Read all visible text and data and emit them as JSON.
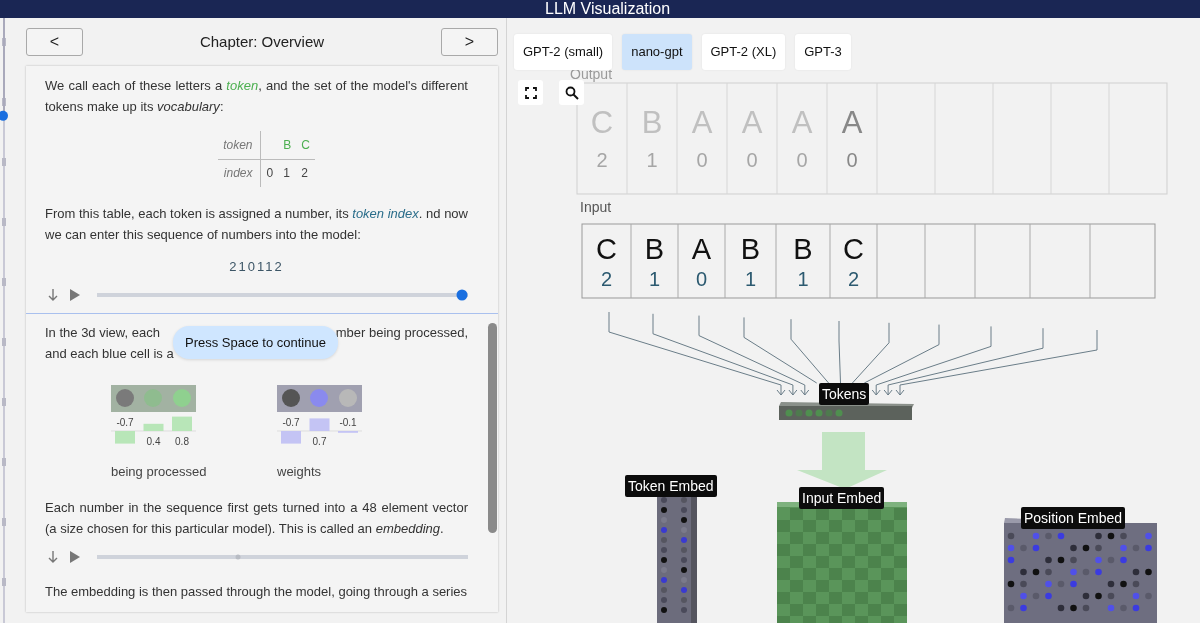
{
  "header": {
    "title": "LLM Visualization"
  },
  "chapter_progress": {
    "level": 0.17
  },
  "chapter_nav": {
    "prev": "<",
    "title": "Chapter: Overview",
    "next": ">"
  },
  "article": [
    {
      "kind": "paragraph",
      "parts": [
        {
          "kind": "text",
          "text": "We call each of these letters a "
        },
        {
          "kind": "term",
          "color": "#4caf50",
          "text": "token"
        },
        {
          "kind": "text",
          "text": ", and the set of the model's different tokens make up its "
        },
        {
          "kind": "emphasis",
          "text": "vocabulary"
        },
        {
          "kind": "text",
          "text": ":"
        }
      ]
    },
    {
      "kind": "vocab_table",
      "row_headers": [
        "token",
        "index"
      ],
      "columns": [
        {
          "index": "0"
        },
        {
          "token": "B",
          "index": "1"
        },
        {
          "token": "C",
          "index": "2"
        }
      ]
    },
    {
      "kind": "paragraph",
      "parts": [
        {
          "kind": "text",
          "text": "From this table, each token is assigned a number, its "
        },
        {
          "kind": "term",
          "color": "#2a6d8a",
          "text": "token index"
        },
        {
          "kind": "text",
          "text": ".   nd now we can enter this sequence of numbers into the model:"
        }
      ]
    },
    {
      "kind": "sequence",
      "text": "210112"
    },
    {
      "kind": "player",
      "active": true,
      "level": 1
    },
    {
      "kind": "occluded_paragraph",
      "lines": [
        [
          "In the 3d view, each",
          "mber being processed,"
        ],
        [
          "and each blue cell is a"
        ]
      ],
      "tooltip": "Press Space to continue"
    },
    {
      "kind": "legend",
      "items": [
        {
          "caption": "being processed",
          "cells": [
            {
              "color": "#7a7a7a"
            },
            {
              "color": "#8fbc8f"
            },
            {
              "color": "#8fd08f"
            }
          ],
          "bars": {
            "color": "#b8e6b8",
            "labels": [
              "-0.7",
              "0.4",
              "0.8"
            ]
          }
        },
        {
          "caption": "weights",
          "cells": [
            {
              "color": "#555555"
            },
            {
              "color": "#8a8aee"
            },
            {
              "color": "#b8b8b8"
            }
          ],
          "bars": {
            "color": "#c4c4f4",
            "labels": [
              "-0.7",
              "0.7",
              "-0.1"
            ]
          }
        }
      ]
    },
    {
      "kind": "paragraph",
      "parts": [
        {
          "kind": "text",
          "text": "Each number in the sequence first gets turned into a 48 element vector (a size chosen for this particular model). This is called an "
        },
        {
          "kind": "emphasis",
          "text": "embedding"
        },
        {
          "kind": "text",
          "text": "."
        }
      ]
    },
    {
      "kind": "player",
      "active": false,
      "level": 0.375
    },
    {
      "kind": "paragraph",
      "parts": [
        {
          "kind": "text",
          "text": "The embedding is then passed through the model, going through a series"
        }
      ]
    }
  ],
  "model_tabs": [
    {
      "label": "GPT-2 (small)",
      "selected": false
    },
    {
      "label": "nano-gpt",
      "selected": true
    },
    {
      "label": "GPT-2 (XL)",
      "selected": false
    },
    {
      "label": "GPT-3",
      "selected": false
    }
  ],
  "output": {
    "label": "Output",
    "cells": [
      {
        "token": "C",
        "index": "2",
        "highlighted": false
      },
      {
        "token": "B",
        "index": "1",
        "highlighted": false
      },
      {
        "token": "A",
        "index": "0",
        "highlighted": false
      },
      {
        "token": "A",
        "index": "0",
        "highlighted": false
      },
      {
        "token": "A",
        "index": "0",
        "highlighted": false
      },
      {
        "token": "A",
        "index": "0",
        "highlighted": true
      }
    ]
  },
  "input": {
    "label": "Input",
    "cells": [
      {
        "token": "C",
        "index": "2"
      },
      {
        "token": "B",
        "index": "1"
      },
      {
        "token": "A",
        "index": "0"
      },
      {
        "token": "B",
        "index": "1"
      },
      {
        "token": "B",
        "index": "1"
      },
      {
        "token": "C",
        "index": "2"
      }
    ]
  },
  "blocks": [
    {
      "kind": "tokens",
      "label": "Tokens"
    },
    {
      "kind": "token_embed",
      "label": "Token Embed"
    },
    {
      "kind": "input_embed",
      "label": "Input Embed"
    },
    {
      "kind": "position_embed",
      "label": "Position Embed"
    }
  ]
}
